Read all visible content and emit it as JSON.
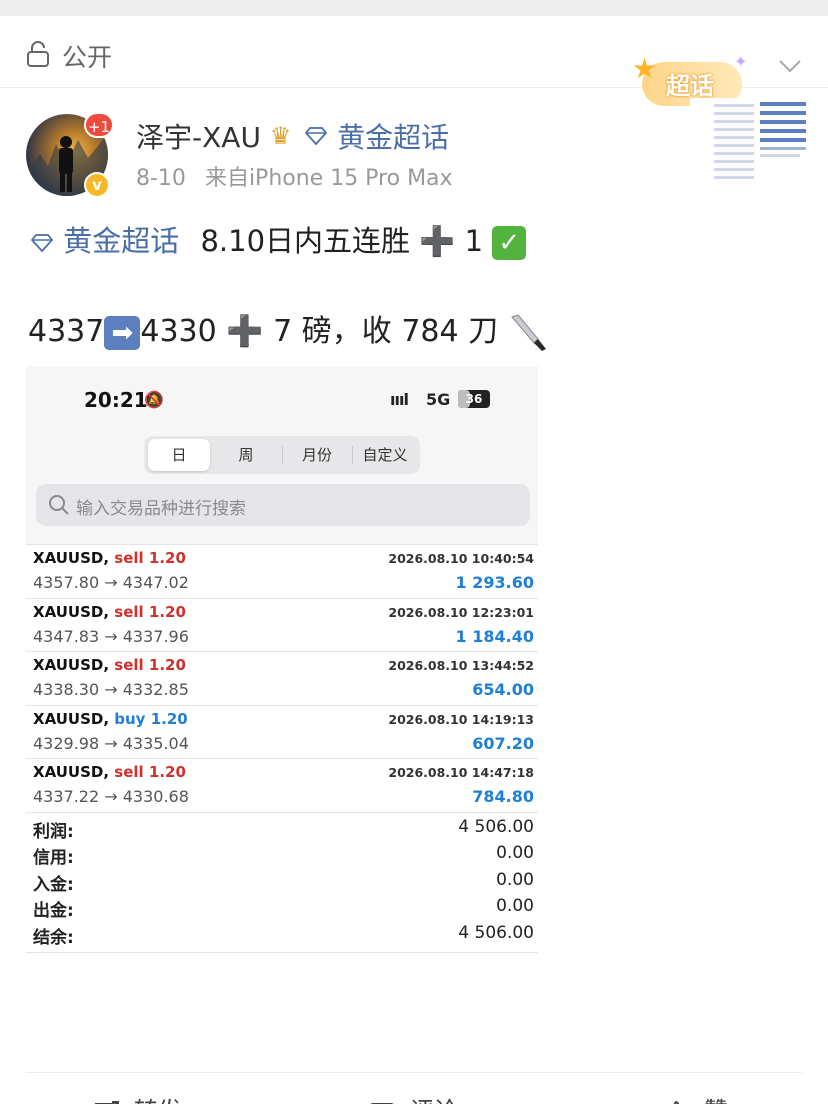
{
  "privacy": {
    "label": "公开"
  },
  "badge": {
    "label": "超话"
  },
  "author": {
    "name": "泽宇-XAU",
    "supertopic": "黄金超话",
    "notification_count": "+1",
    "verified_mark": "v",
    "date": "8-10",
    "source": "来自iPhone 15 Pro Max"
  },
  "post": {
    "topic": "黄金超话",
    "line1_text": "8.10日内五连胜",
    "line1_plus": "➕",
    "line1_count": "1",
    "line1_check": "✓",
    "line2_from": "4337",
    "line2_arrow": "➡",
    "line2_to": "4330",
    "line2_plus": "➕",
    "line2_rest": "7 磅，收 784 刀"
  },
  "screenshot": {
    "time": "20:21",
    "network": "5G",
    "battery": "36",
    "battery_level": 0.36,
    "tabs": [
      "日",
      "周",
      "月份",
      "自定义"
    ],
    "active_tab": "日",
    "search_placeholder": "输入交易品种进行搜索",
    "trades": [
      {
        "symbol": "XAUUSD,",
        "side": "sell",
        "volume": "1.20",
        "date": "2026.08.10 10:40:54",
        "prices": "4357.80 → 4347.02",
        "profit": "1 293.60"
      },
      {
        "symbol": "XAUUSD,",
        "side": "sell",
        "volume": "1.20",
        "date": "2026.08.10 12:23:01",
        "prices": "4347.83 → 4337.96",
        "profit": "1 184.40"
      },
      {
        "symbol": "XAUUSD,",
        "side": "sell",
        "volume": "1.20",
        "date": "2026.08.10 13:44:52",
        "prices": "4338.30 → 4332.85",
        "profit": "654.00"
      },
      {
        "symbol": "XAUUSD,",
        "side": "buy",
        "volume": "1.20",
        "date": "2026.08.10 14:19:13",
        "prices": "4329.98 → 4335.04",
        "profit": "607.20"
      },
      {
        "symbol": "XAUUSD,",
        "side": "sell",
        "volume": "1.20",
        "date": "2026.08.10 14:47:18",
        "prices": "4337.22 → 4330.68",
        "profit": "784.80"
      }
    ],
    "summary": [
      {
        "label": "利润:",
        "value": "4 506.00"
      },
      {
        "label": "信用:",
        "value": "0.00"
      },
      {
        "label": "入金:",
        "value": "0.00"
      },
      {
        "label": "出金:",
        "value": "0.00"
      },
      {
        "label": "结余:",
        "value": "4 506.00"
      }
    ]
  },
  "actions": {
    "repost": "转发",
    "comment": "评论",
    "like": "赞"
  },
  "colors": {
    "topic_blue": "#4a6ea8",
    "sell_red": "#d0312d",
    "profit_blue": "#1f7fd6"
  }
}
